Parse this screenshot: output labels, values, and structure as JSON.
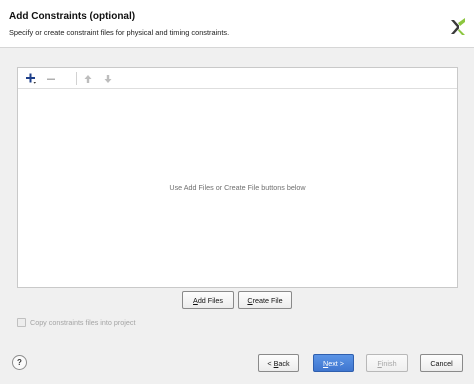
{
  "header": {
    "title": "Add Constraints (optional)",
    "subtitle": "Specify or create constraint files for physical and timing constraints."
  },
  "toolbar": {
    "add_icon": "plus-icon",
    "remove_icon": "minus-icon",
    "move_up_icon": "arrow-up-icon",
    "move_down_icon": "arrow-down-icon"
  },
  "file_list": {
    "empty_message": "Use Add Files or Create File buttons below"
  },
  "actions": {
    "add_files_prefix": "",
    "add_files_accel": "A",
    "add_files_rest": "dd Files",
    "create_file_prefix": "",
    "create_file_accel": "C",
    "create_file_rest": "reate File"
  },
  "options": {
    "copy_constraints_label": "Copy constraints files into project",
    "copy_constraints_checked": false,
    "copy_constraints_enabled": false
  },
  "footer": {
    "help_label": "?",
    "back_prefix": "< ",
    "back_accel": "B",
    "back_rest": "ack",
    "next_prefix": "",
    "next_accel": "N",
    "next_rest": "ext >",
    "finish_prefix": "",
    "finish_accel": "F",
    "finish_rest": "inish",
    "cancel_label": "Cancel"
  },
  "colors": {
    "primary_button": "#4a84dc",
    "logo_green": "#8cc63f"
  }
}
